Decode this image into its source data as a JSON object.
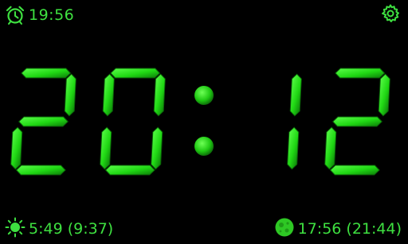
{
  "alarm": {
    "icon": "alarm-clock-icon",
    "time": "19:56"
  },
  "settings": {
    "icon": "gear-icon"
  },
  "clock": {
    "hours": "20",
    "minutes": "12",
    "digits": [
      "2",
      "0",
      "1",
      "2"
    ],
    "separator": ":"
  },
  "sun": {
    "icon": "sun-icon",
    "text": "5:49 (9:37)"
  },
  "moon": {
    "icon": "moon-icon",
    "text": "17:56 (21:44)"
  },
  "colors": {
    "accent": "#3ee040",
    "segment": "#22e016",
    "segment_shade": "#0a5d08",
    "background": "#000000"
  }
}
